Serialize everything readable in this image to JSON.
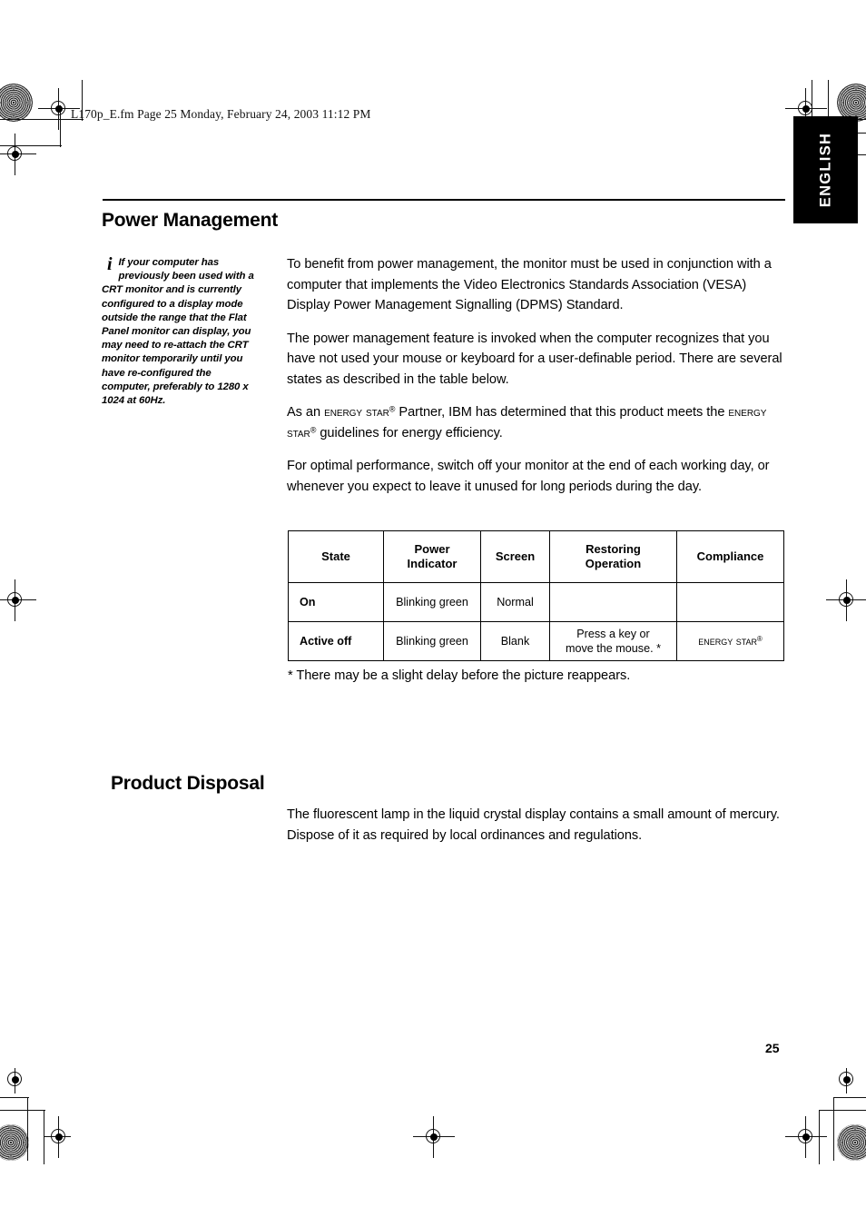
{
  "header": {
    "file_line": "L170p_E.fm  Page 25  Monday, February 24, 2003  11:12 PM"
  },
  "language_tab": {
    "label": "ENGLISH"
  },
  "sections": {
    "power_management": {
      "title": "Power Management",
      "note": {
        "icon": "info-italic-i-icon",
        "text": "If your computer has previously been used with a CRT monitor and is currently configured to a display mode outside the range that the Flat Panel monitor can display, you may need to re-attach the CRT monitor temporarily until you have re-configured the computer, preferably to 1280 x 1024 at 60Hz."
      },
      "paragraphs": [
        "To benefit from power management, the monitor must be used in conjunction with a computer that implements the Video Electronics Standards Association (VESA) Display Power Management Signalling (DPMS) Standard.",
        "The power management feature is invoked when the computer recognizes that you have not used your mouse or keyboard for a user-definable period. There are several states as described in the table below.",
        "For optimal performance, switch off your monitor at the end of each working day, or whenever you expect to leave it unused for long periods during the day."
      ],
      "energy_star_paragraph": {
        "part1": "As an ",
        "brand1": "Energy Star",
        "part2": " Partner, IBM has determined that this product meets the ",
        "brand2": "Energy Star",
        "part3": " guidelines for energy efficiency.",
        "registered_symbol": "®"
      },
      "footnote": "* There may be a slight delay before the picture reappears."
    },
    "product_disposal": {
      "title": "Product Disposal",
      "paragraphs": [
        "The fluorescent lamp in the liquid crystal display contains a small amount of mercury. Dispose of it as required by local ordinances and regulations."
      ]
    }
  },
  "state_table": {
    "columns": [
      "State",
      "Power Indicator",
      "Screen",
      "Restoring Operation",
      "Compliance"
    ],
    "column_lines": {
      "power_indicator_line1": "Power",
      "power_indicator_line2": "Indicator",
      "restoring_line1": "Restoring",
      "restoring_line2": "Operation"
    },
    "rows": [
      {
        "state": "On",
        "power_indicator": "Blinking green",
        "screen": "Normal",
        "restoring_operation": "",
        "compliance": ""
      },
      {
        "state": "Active off",
        "power_indicator": "Blinking green",
        "screen": "Blank",
        "restoring_operation_line1": "Press a key or",
        "restoring_operation_line2": "move the mouse. *",
        "compliance_brand": "Energy Star",
        "compliance_symbol": "®"
      }
    ]
  },
  "footer": {
    "page_number": "25"
  },
  "colors": {
    "text": "#000000",
    "page_background": "#ffffff",
    "tab_background": "#000000",
    "tab_text": "#ffffff",
    "rule": "#000000"
  }
}
